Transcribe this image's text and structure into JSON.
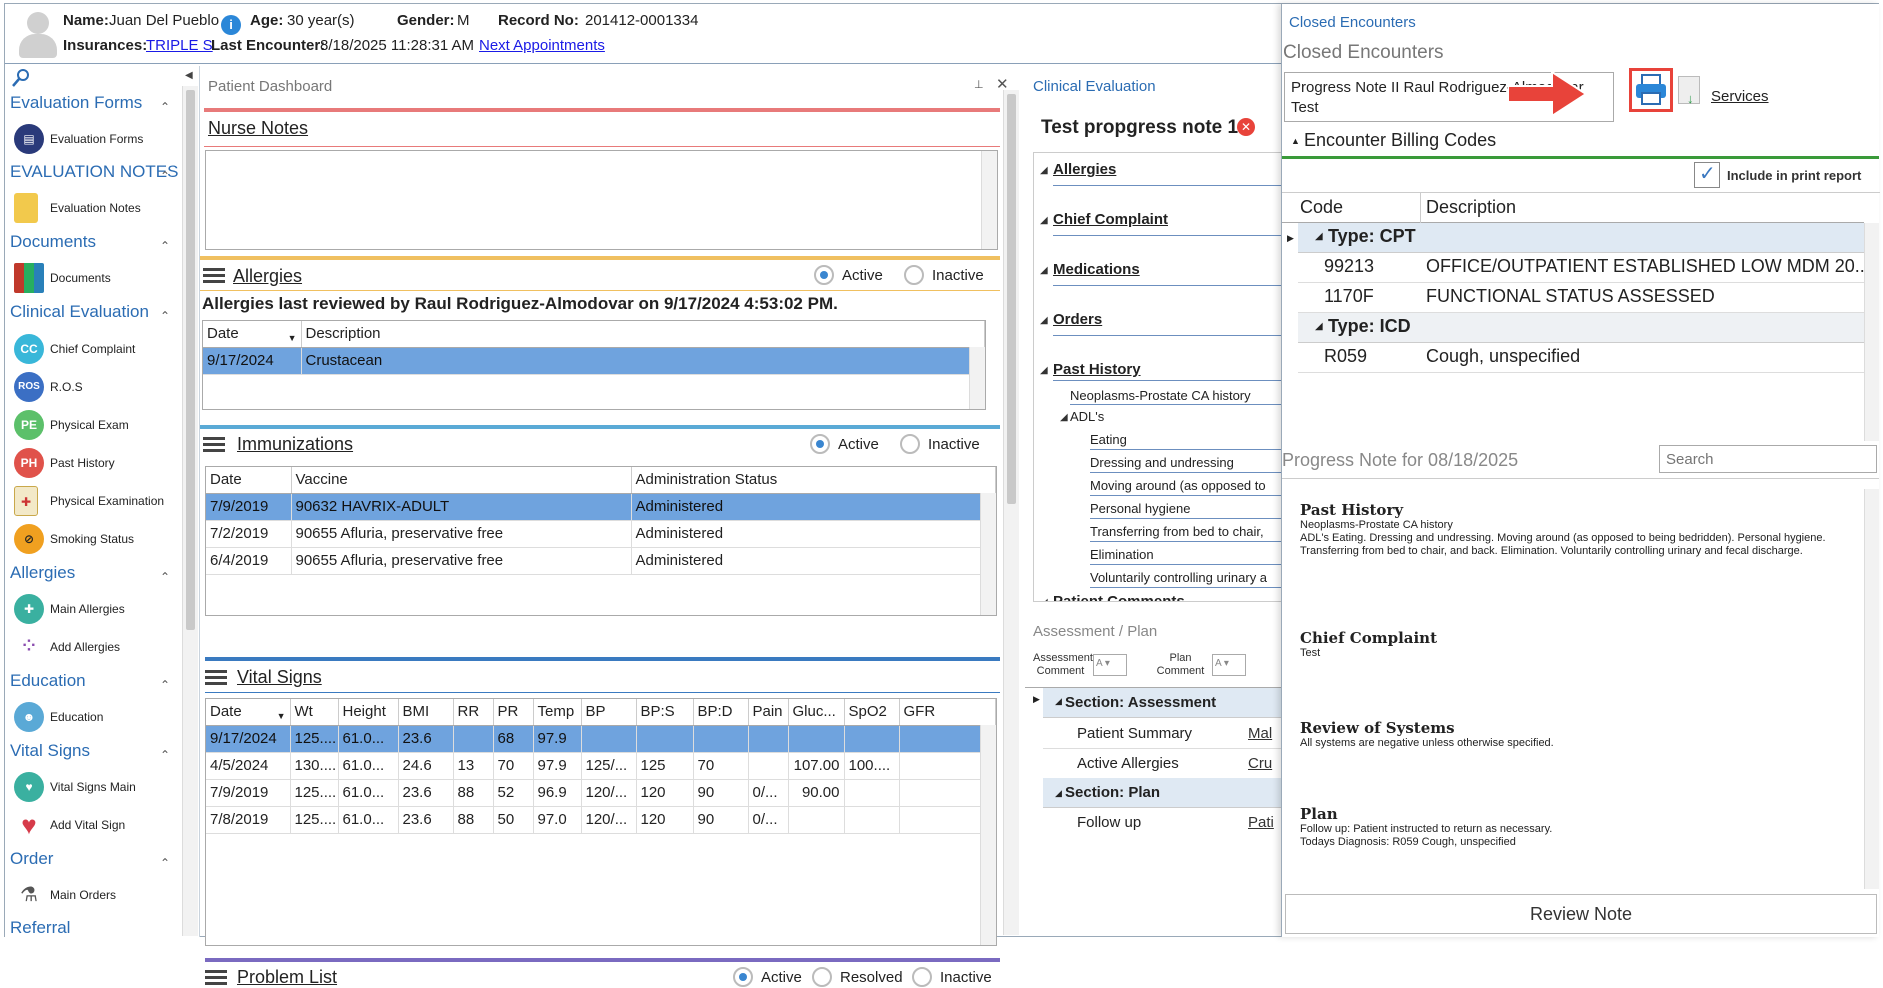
{
  "header": {
    "name_label": "Name:",
    "name_value": "Juan Del Pueblo",
    "age_label": "Age:",
    "age_value": "30 year(s)",
    "gender_label": "Gender:",
    "gender_value": "M",
    "record_label": "Record No:",
    "record_value": "201412-0001334",
    "insurances_label": "Insurances:",
    "insurance_link": "TRIPLE S",
    "last_enc_label": "Last Encounter:",
    "last_enc_value": "8/18/2025 11:28:31 AM",
    "next_appts_link": "Next Appointments"
  },
  "sidebar": {
    "sections": [
      {
        "title": "Evaluation Forms",
        "items": [
          "Evaluation Forms"
        ]
      },
      {
        "title": "EVALUATION NOTES",
        "items": [
          "Evaluation Notes"
        ]
      },
      {
        "title": "Documents",
        "items": [
          "Documents"
        ]
      },
      {
        "title": "Clinical Evaluation",
        "items": [
          "Chief Complaint",
          "R.O.S",
          "Physical Exam",
          "Past History",
          "Physical Examination",
          "Smoking Status"
        ]
      },
      {
        "title": "Allergies",
        "items": [
          "Main Allergies",
          "Add Allergies"
        ]
      },
      {
        "title": "Education",
        "items": [
          "Education"
        ]
      },
      {
        "title": "Vital Signs",
        "items": [
          "Vital Signs Main",
          "Add Vital Sign"
        ]
      },
      {
        "title": "Order",
        "items": [
          "Main Orders"
        ]
      },
      {
        "title": "Referral",
        "items": []
      }
    ],
    "icon_badges": {
      "cc": "CC",
      "ros": "ROS",
      "pe": "PE",
      "ph": "PH"
    }
  },
  "dashboard": {
    "title": "Patient Dashboard",
    "nurse_notes_title": "Nurse Notes",
    "allergies": {
      "title": "Allergies",
      "active": "Active",
      "inactive": "Inactive",
      "reviewed_text": "Allergies last reviewed by Raul Rodriguez-Almodovar on 9/17/2024 4:53:02 PM.",
      "columns": [
        "Date",
        "Description"
      ],
      "rows": [
        [
          "9/17/2024",
          "Crustacean"
        ]
      ]
    },
    "immunizations": {
      "title": "Immunizations",
      "active": "Active",
      "inactive": "Inactive",
      "columns": [
        "Date",
        "Vaccine",
        "Administration Status"
      ],
      "rows": [
        [
          "7/9/2019",
          "90632 HAVRIX-ADULT",
          "Administered"
        ],
        [
          "7/2/2019",
          "90655 Afluria, preservative free",
          "Administered"
        ],
        [
          "6/4/2019",
          "90655 Afluria, preservative free",
          "Administered"
        ]
      ]
    },
    "vitals": {
      "title": "Vital Signs",
      "columns": [
        "Date",
        "Wt",
        "Height",
        "BMI",
        "RR",
        "PR",
        "Temp",
        "BP",
        "BP:S",
        "BP:D",
        "Pain",
        "Gluc...",
        "SpO2",
        "GFR"
      ],
      "rows": [
        [
          "9/17/2024",
          "125....",
          "61.0...",
          "23.6",
          "",
          "68",
          "97.9",
          "",
          "",
          "",
          "",
          "",
          "",
          ""
        ],
        [
          "4/5/2024",
          "130....",
          "61.0...",
          "24.6",
          "13",
          "70",
          "97.9",
          "125/...",
          "125",
          "70",
          "",
          "107.00",
          "100....",
          ""
        ],
        [
          "7/9/2019",
          "125....",
          "61.0...",
          "23.6",
          "88",
          "52",
          "96.9",
          "120/...",
          "120",
          "90",
          "0/...",
          "90.00",
          "",
          ""
        ],
        [
          "7/8/2019",
          "125....",
          "61.0...",
          "23.6",
          "88",
          "50",
          "97.0",
          "120/...",
          "120",
          "90",
          "0/...",
          "",
          "",
          ""
        ]
      ]
    },
    "problems": {
      "title": "Problem List",
      "active": "Active",
      "resolved": "Resolved",
      "inactive": "Inactive"
    }
  },
  "clinical": {
    "title": "Clinical Evaluation",
    "note_title": "Test propgress note 1",
    "sections": [
      "Allergies",
      "Chief Complaint",
      "Medications",
      "Orders",
      "Past History"
    ],
    "past_history_items": [
      "Neoplasms-Prostate CA history",
      "ADL's"
    ],
    "adl_items": [
      "Eating",
      "Dressing and undressing",
      "Moving around (as opposed to",
      "Personal hygiene",
      "Transferring from bed to chair,",
      "Elimination",
      "Voluntarily controlling urinary a"
    ],
    "patient_comments": "Patient Comments"
  },
  "assessment": {
    "title": "Assessment / Plan",
    "assessment_comment": "Assessment Comment",
    "plan_comment": "Plan Comment",
    "sec_assessment": "Section: Assessment",
    "patient_summary": "Patient Summary",
    "patient_summary_val": "Mal",
    "active_allergies": "Active Allergies",
    "active_allergies_val": "Cru",
    "sec_plan": "Section: Plan",
    "follow_up": "Follow up",
    "follow_up_val": "Pati"
  },
  "right_panel": {
    "tab_title": "Closed Encounters",
    "heading": "Closed Encounters",
    "encounter_line1": "Progress Note II Raul Rodriguez-Almodovar",
    "encounter_line2": "Test",
    "services": "Services",
    "billing_title": "Encounter Billing Codes",
    "include_print": "Include in print report",
    "columns": [
      "Code",
      "Description"
    ],
    "type_cpt": "Type: CPT",
    "type_icd": "Type: ICD",
    "cpt_rows": [
      [
        "99213",
        "OFFICE/OUTPATIENT ESTABLISHED LOW MDM 20..."
      ],
      [
        "1170F",
        "FUNCTIONAL STATUS ASSESSED"
      ]
    ],
    "icd_rows": [
      [
        "R059",
        "Cough, unspecified"
      ]
    ],
    "progress_note_title": "Progress Note for 08/18/2025",
    "search_placeholder": "Search",
    "note_sections": [
      {
        "h": "Past History",
        "t": "Neoplasms-Prostate CA history\nADL's Eating. Dressing and undressing. Moving around (as opposed to being bedridden). Personal hygiene. Transferring from bed to chair, and back. Elimination. Voluntarily controlling urinary and fecal discharge."
      },
      {
        "h": "Chief Complaint",
        "t": "Test"
      },
      {
        "h": "Review of Systems",
        "t": "All systems are negative unless otherwise specified."
      },
      {
        "h": "Plan",
        "t": "Follow up: Patient instructed to return as necessary.\nTodays Diagnosis: R059 Cough, unspecified"
      }
    ],
    "review_note": "Review Note",
    "accent_red": "#e8433a",
    "accent_green": "#3a9a3a"
  }
}
